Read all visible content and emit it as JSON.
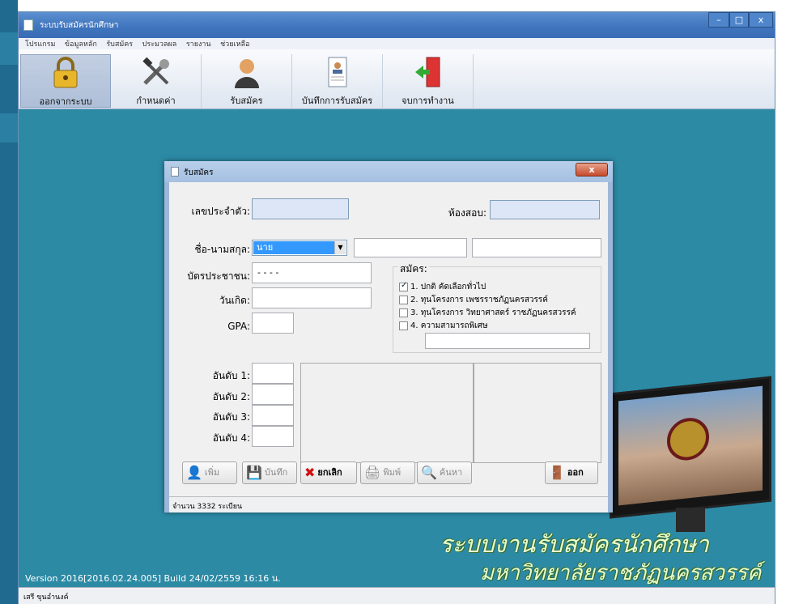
{
  "window": {
    "title": "ระบบรับสมัครนักศึกษา",
    "min": "–",
    "max": "□",
    "close": "x"
  },
  "menu": [
    "โปรแกรม",
    "ข้อมูลหลัก",
    "รับสมัคร",
    "ประมวลผล",
    "รายงาน",
    "ช่วยเหลือ"
  ],
  "toolbar": {
    "logout": "ออกจากระบบ",
    "settings": "กำหนดค่า",
    "apply": "รับสมัคร",
    "record": "บันทึกการรับสมัคร",
    "exit": "จบการทำงาน"
  },
  "version": "Version 2016[2016.02.24.005] Build 24/02/2559 16:16 น.",
  "status_user": "เสรี ขุนอำนงค์",
  "brand": {
    "line1": "ระบบงานรับสมัครนักศึกษา",
    "line2": "มหาวิทยาลัยราชภัฏนครสวรรค์"
  },
  "dialog": {
    "title": "รับสมัคร",
    "close": "x",
    "id_label": "เลขประจำตัว:",
    "room_label": "ห้องสอบ:",
    "name_label": "ชื่อ-นามสกุล:",
    "prefix_value": "นาย",
    "idcard_label": "บัตรประชาชน:",
    "idcard_mask": "-   -   - -",
    "birth_label": "วันเกิด:",
    "gpa_label": "GPA:",
    "apply_group": "สมัคร:",
    "options": [
      {
        "label": "1. ปกติ  คัดเลือกทั่วไป",
        "checked": true
      },
      {
        "label": "2. ทุนโครงการ เพชรราชภัฏนครสวรรค์",
        "checked": false
      },
      {
        "label": "3. ทุนโครงการ วิทยาศาสตร์ ราชภัฏนครสวรรค์",
        "checked": false
      },
      {
        "label": "4. ความสามารถพิเศษ",
        "checked": false
      }
    ],
    "rank1": "อันดับ 1:",
    "rank2": "อันดับ 2:",
    "rank3": "อันดับ 3:",
    "rank4": "อันดับ 4:",
    "buttons": {
      "add": "เพิ่ม",
      "save": "บันทึก",
      "cancel": "ยกเลิก",
      "print": "พิมพ์",
      "search": "ค้นหา",
      "exit": "ออก"
    },
    "status": "จำนวน 3332 ระเบียน"
  }
}
